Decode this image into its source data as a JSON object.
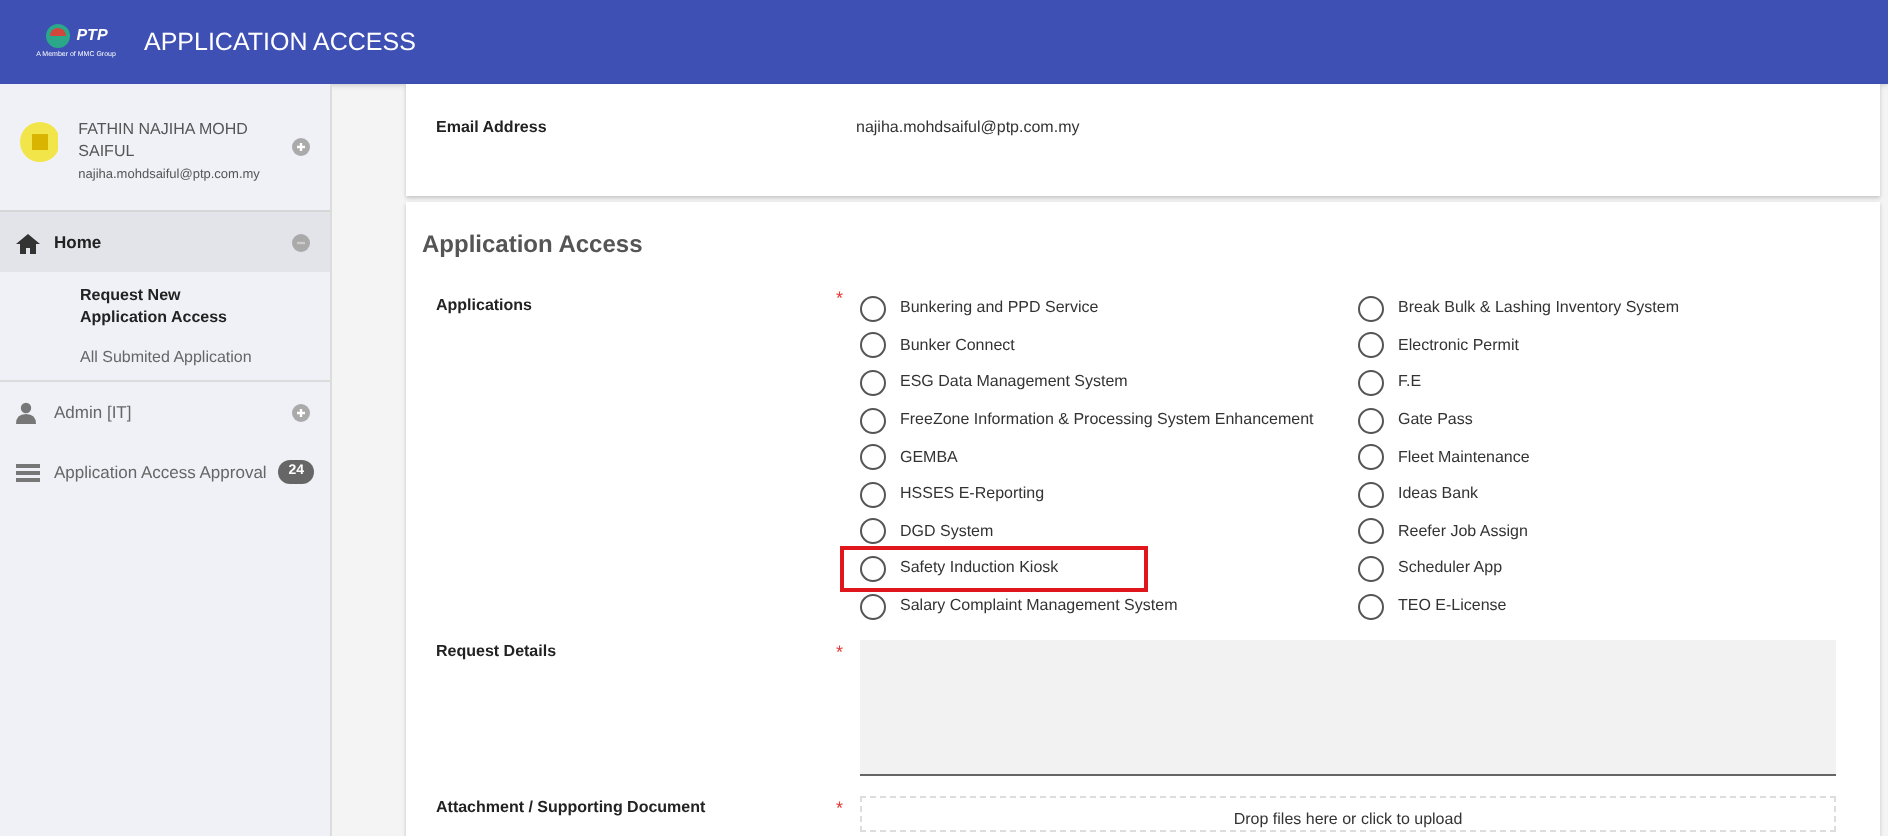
{
  "header": {
    "logo_text": "PTP",
    "logo_tagline": "A Member of MMC Group",
    "title": "APPLICATION ACCESS"
  },
  "user": {
    "name": "FATHIN NAJIHA MOHD SAIFUL",
    "email": "najiha.mohdsaiful@ptp.com.my"
  },
  "sidebar": {
    "items": [
      {
        "label": "Home",
        "kind": "home",
        "expanded": true,
        "selected": true,
        "children": [
          {
            "label": "Request New Application Access",
            "selected": true
          },
          {
            "label": "All Submited Application",
            "selected": false
          }
        ]
      },
      {
        "label": "Admin [IT]",
        "kind": "admin",
        "expanded": false,
        "selected": false
      },
      {
        "label": "Application Access Approval",
        "kind": "approval",
        "selected": false,
        "badge": "24"
      }
    ]
  },
  "email_field": {
    "label": "Email Address",
    "value": "najiha.mohdsaiful@ptp.com.my"
  },
  "section_title": "Application Access",
  "applications": {
    "label": "Applications",
    "required_mark": "*",
    "columns": [
      [
        {
          "label": "Bunkering and PPD Service",
          "selected": false,
          "highlighted": false
        },
        {
          "label": "Bunker Connect",
          "selected": false,
          "highlighted": false
        },
        {
          "label": "ESG Data Management System",
          "selected": false,
          "highlighted": false
        },
        {
          "label": "FreeZone Information & Processing System Enhancement",
          "selected": false,
          "highlighted": false
        },
        {
          "label": "GEMBA",
          "selected": false,
          "highlighted": false
        },
        {
          "label": "HSSES E-Reporting",
          "selected": false,
          "highlighted": false
        },
        {
          "label": "DGD System",
          "selected": false,
          "highlighted": false
        },
        {
          "label": "Safety Induction Kiosk",
          "selected": false,
          "highlighted": true
        },
        {
          "label": "Salary Complaint Management System",
          "selected": false,
          "highlighted": false
        }
      ],
      [
        {
          "label": "Break Bulk & Lashing Inventory System",
          "selected": false,
          "highlighted": false
        },
        {
          "label": "Electronic Permit",
          "selected": false,
          "highlighted": false
        },
        {
          "label": "F.E",
          "selected": false,
          "highlighted": false
        },
        {
          "label": "Gate Pass",
          "selected": false,
          "highlighted": false
        },
        {
          "label": "Fleet Maintenance",
          "selected": false,
          "highlighted": false
        },
        {
          "label": "Ideas Bank",
          "selected": false,
          "highlighted": false
        },
        {
          "label": "Reefer Job Assign",
          "selected": false,
          "highlighted": false
        },
        {
          "label": "Scheduler App",
          "selected": false,
          "highlighted": false
        },
        {
          "label": "TEO E-License",
          "selected": false,
          "highlighted": false
        }
      ]
    ]
  },
  "request_details": {
    "label": "Request Details",
    "required_mark": "*"
  },
  "attachment": {
    "label": "Attachment / Supporting Document",
    "required_mark": "*",
    "placeholder": "Drop files here or click to upload"
  }
}
